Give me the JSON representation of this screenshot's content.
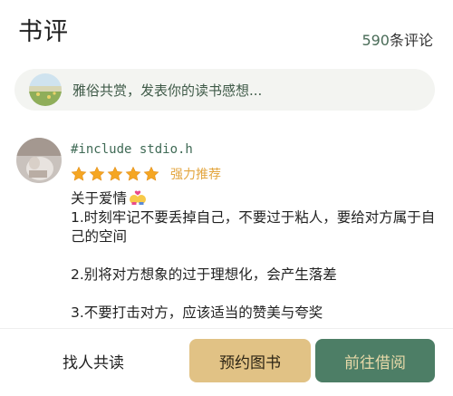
{
  "header": {
    "title": "书评",
    "comment_count": "590",
    "comment_suffix": "条评论"
  },
  "search": {
    "placeholder": "雅俗共赏，发表你的读书感想..."
  },
  "review": {
    "username": "#include stdio.h",
    "stars": 5,
    "rating_label": "强力推荐",
    "lines": [
      "关于爱情",
      "1.时刻牢记不要丢掉自己，不要过于粘人，要给对方属于自己的空间",
      "2.别将对方想象的过于理想化，会产生落差",
      "3.不要打击对方，应该适当的赞美与夸奖"
    ]
  },
  "actions": {
    "read_together": "找人共读",
    "reserve": "预约图书",
    "borrow": "前往借阅"
  },
  "colors": {
    "accent_green": "#4d7e66",
    "accent_gold": "#e1c285",
    "star_color": "#f5a623",
    "search_bg": "#f3f4f1"
  }
}
